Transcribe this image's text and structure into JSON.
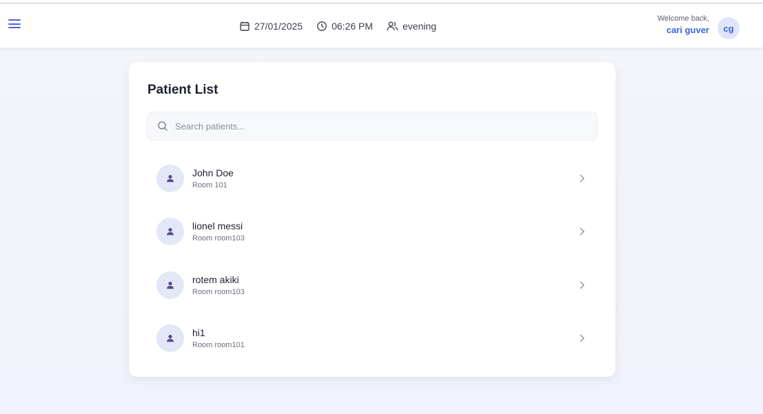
{
  "header": {
    "date": "27/01/2025",
    "time": "06:26 PM",
    "shift": "evening",
    "welcome_text": "Welcome back,",
    "user_name": "cari guver",
    "user_initials": "cg"
  },
  "main": {
    "title": "Patient List",
    "search_placeholder": "Search patients...",
    "patients": [
      {
        "name": "John Doe",
        "room": "Room 101"
      },
      {
        "name": "lionel messi",
        "room": "Room room103"
      },
      {
        "name": "rotem akiki",
        "room": "Room room103"
      },
      {
        "name": "hi1",
        "room": "Room room101"
      }
    ]
  },
  "colors": {
    "accent": "#3e63dd",
    "avatar_bg": "#e3e8f8",
    "patient_icon": "#5b4a86"
  },
  "icons": {
    "menu": "menu-icon",
    "date": "calendar-icon",
    "time": "clock-icon",
    "shift": "users-icon",
    "search": "search-icon",
    "patient": "user-icon",
    "row_action": "chevron-right-icon"
  }
}
